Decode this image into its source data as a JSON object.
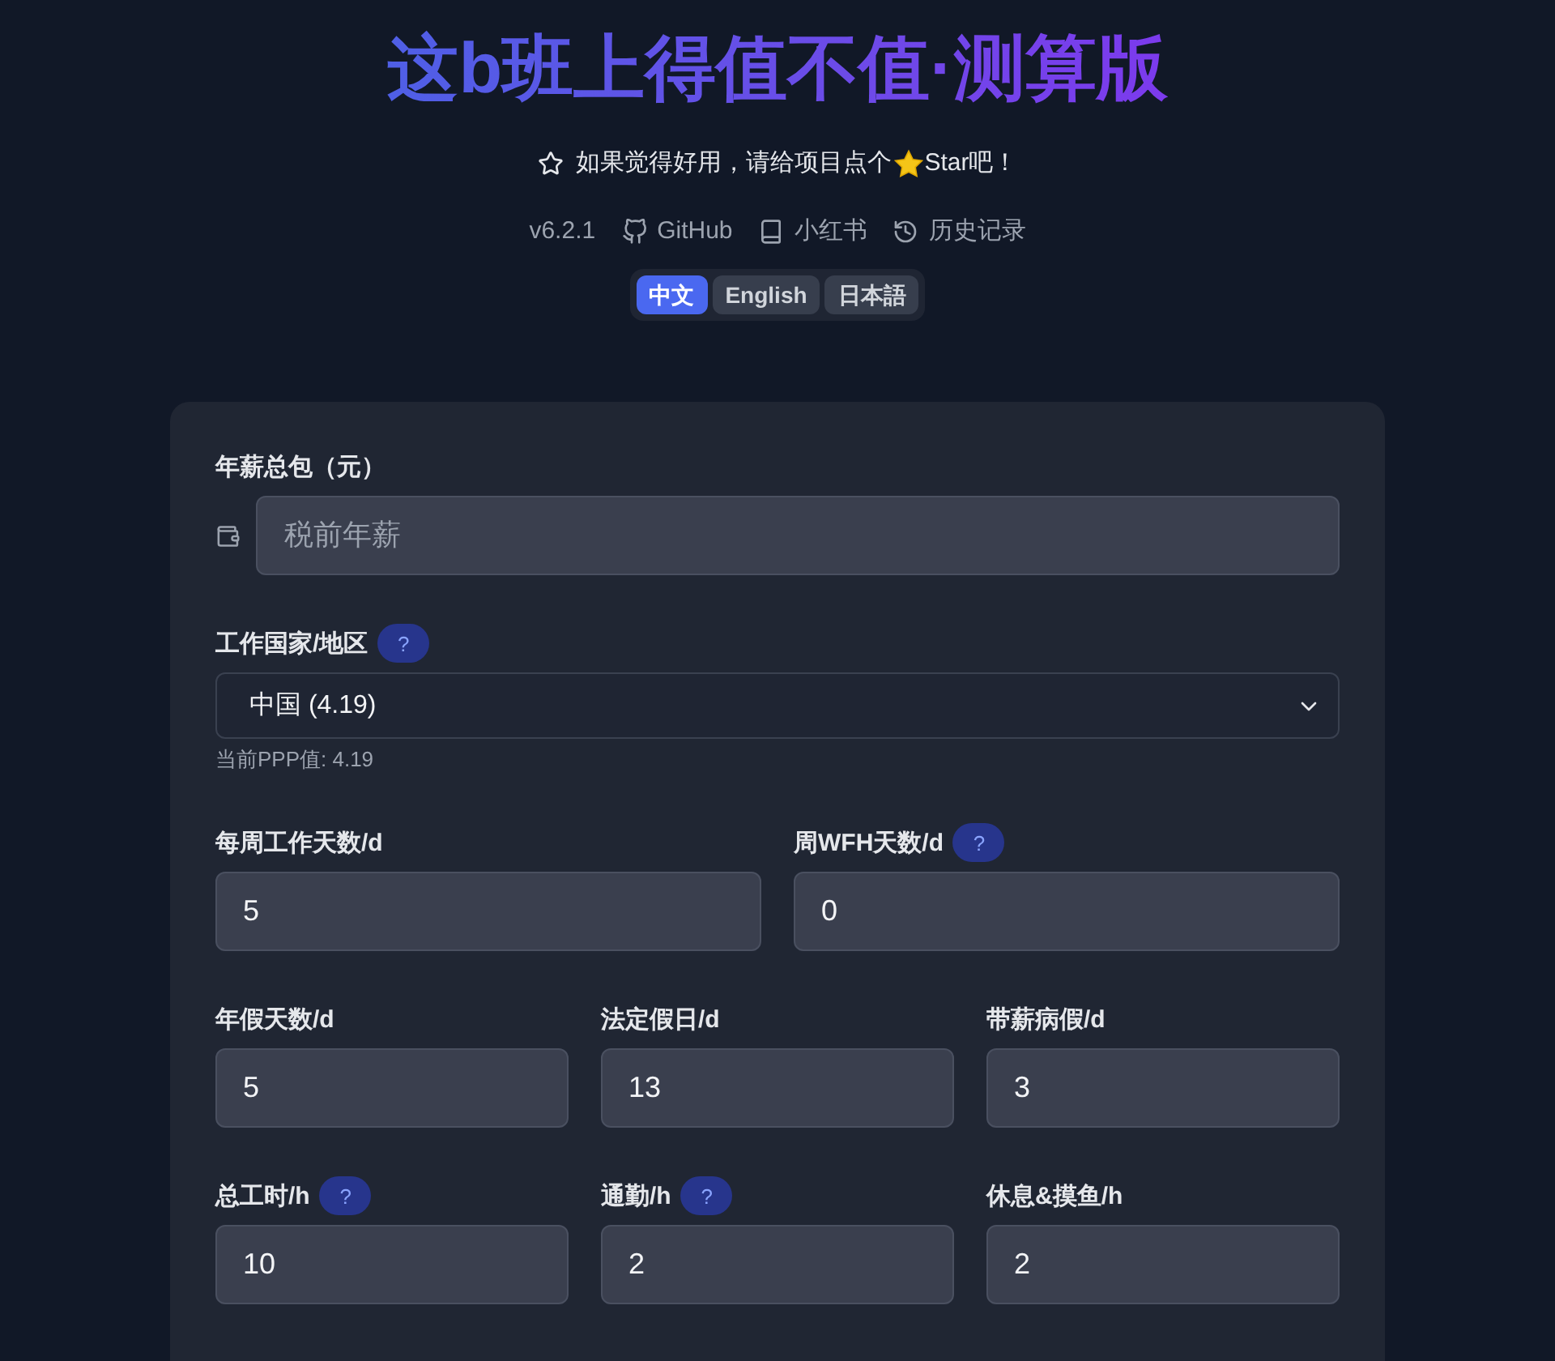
{
  "header": {
    "title": "这b班上得值不值·测算版",
    "star_prompt": {
      "before": "如果觉得好用，请给项目点个",
      "after": "Star吧！"
    },
    "links": [
      {
        "kind": "version",
        "label": "v6.2.1"
      },
      {
        "kind": "github",
        "label": "GitHub"
      },
      {
        "kind": "book",
        "label": "小红书"
      },
      {
        "kind": "history",
        "label": "历史记录"
      }
    ],
    "languages": [
      {
        "label": "中文",
        "selected": true
      },
      {
        "label": "English",
        "selected": false
      },
      {
        "label": "日本語",
        "selected": false
      }
    ]
  },
  "form": {
    "salary": {
      "label": "年薪总包（元）",
      "placeholder": "税前年薪"
    },
    "country": {
      "label": "工作国家/地区",
      "help": "?",
      "value": "中国 (4.19)",
      "hint": "当前PPP值: 4.19"
    },
    "rows": [
      [
        {
          "label": "每周工作天数/d",
          "value": "5"
        },
        {
          "label": "周WFH天数/d",
          "help": "?",
          "value": "0"
        }
      ],
      [
        {
          "label": "年假天数/d",
          "value": "5"
        },
        {
          "label": "法定假日/d",
          "value": "13"
        },
        {
          "label": "带薪病假/d",
          "value": "3"
        }
      ],
      [
        {
          "label": "总工时/h",
          "help": "?",
          "value": "10"
        },
        {
          "label": "通勤/h",
          "help": "?",
          "value": "2"
        },
        {
          "label": "休息&摸鱼/h",
          "value": "2"
        }
      ]
    ]
  }
}
